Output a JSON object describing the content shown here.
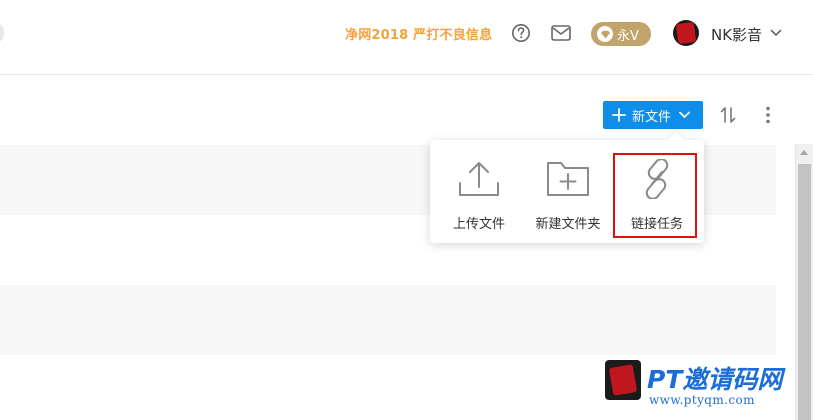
{
  "header": {
    "promo_text": "净网2018 严打不良信息",
    "help_icon": "help-circle-icon",
    "mail_icon": "mail-icon",
    "vip_badge": {
      "label": "永V",
      "icon": "diamond-icon"
    },
    "user": {
      "name": "NK影音",
      "avatar": "avatar-seal"
    }
  },
  "toolbar": {
    "new_file_label": "新文件",
    "sort_icon": "sort-icon",
    "more_icon": "more-vertical-icon"
  },
  "new_menu": {
    "items": [
      {
        "label": "上传文件",
        "icon": "upload-icon"
      },
      {
        "label": "新建文件夹",
        "icon": "new-folder-icon"
      },
      {
        "label": "链接任务",
        "icon": "link-icon",
        "highlighted": true
      }
    ]
  },
  "watermark": {
    "title": "PT邀请码网",
    "url": "www.ptyqm.com"
  },
  "colors": {
    "accent": "#0e8ee9",
    "promo": "#f4a23c",
    "vip": "#c0a46c",
    "highlight": "#e01010",
    "watermark": "#1d6dd8"
  }
}
